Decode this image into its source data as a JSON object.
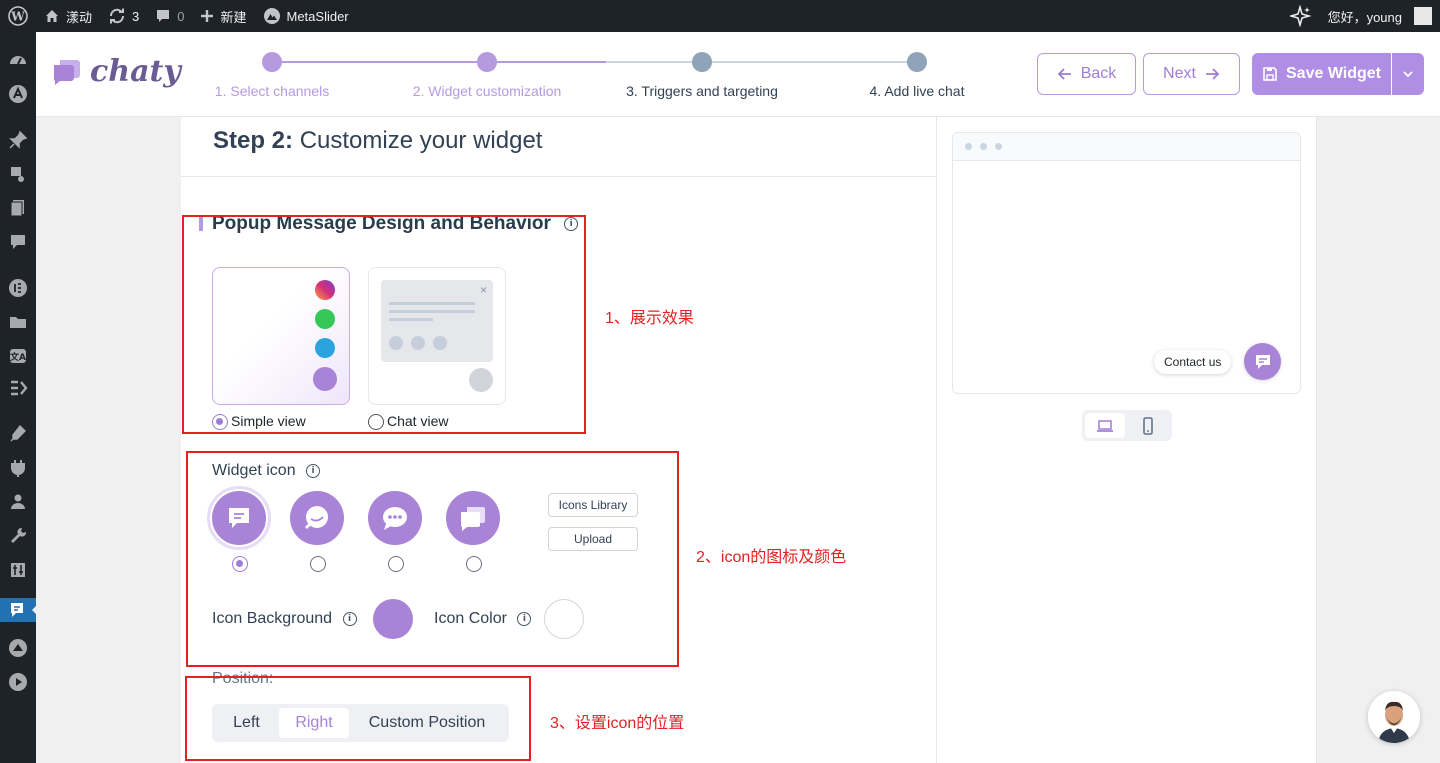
{
  "adminbar": {
    "site_name": "漾动",
    "updates_count": "3",
    "comments_count": "0",
    "new_label": "新建",
    "metaslider_label": "MetaSlider",
    "greeting": "您好，young"
  },
  "header": {
    "logo_text": "chaty",
    "steps": [
      {
        "label": "1. Select channels",
        "state": "done"
      },
      {
        "label": "2. Widget customization",
        "state": "current"
      },
      {
        "label": "3. Triggers and targeting",
        "state": "pending"
      },
      {
        "label": "4. Add live chat",
        "state": "pending"
      }
    ],
    "back_label": "Back",
    "next_label": "Next",
    "save_label": "Save Widget"
  },
  "main": {
    "step_prefix": "Step 2:",
    "step_title": "Customize your widget",
    "popup_section_title": "Popup Message Design and Behavior",
    "view_options": [
      {
        "label": "Simple view",
        "selected": true
      },
      {
        "label": "Chat view",
        "selected": false
      }
    ],
    "widget_icon_label": "Widget icon",
    "icons_library_label": "Icons Library",
    "upload_label": "Upload",
    "selected_icon_index": 0,
    "icon_background_label": "Icon Background",
    "icon_background_color": "#a883d6",
    "icon_color_label": "Icon Color",
    "icon_color": "#ffffff",
    "position_label": "Position:",
    "position_options": [
      "Left",
      "Right",
      "Custom Position"
    ],
    "position_selected": "Right"
  },
  "preview": {
    "contact_label": "Contact us",
    "device": "desktop"
  },
  "annotations": {
    "a1": "1、展示效果",
    "a2": "2、icon的图标及颜色",
    "a3": "3、设置icon的位置"
  },
  "colors": {
    "accent": "#a883d6",
    "annotation": "#e32222",
    "wp_dark": "#1d2327",
    "pending_step": "#8fa4b8"
  }
}
